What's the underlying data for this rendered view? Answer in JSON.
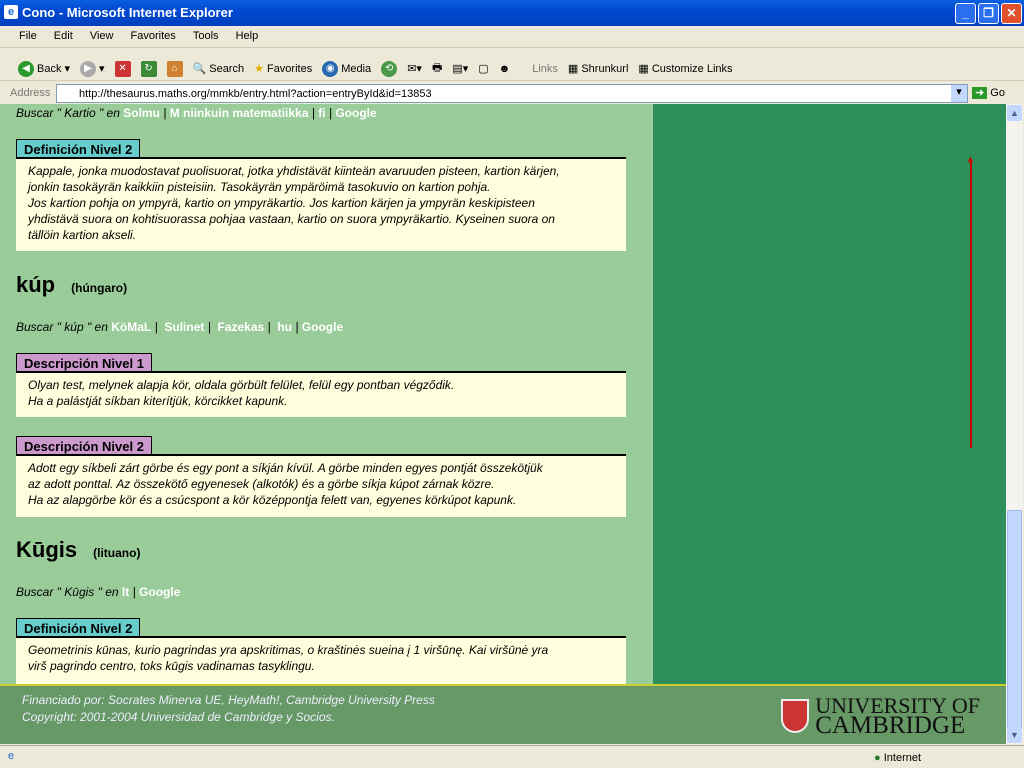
{
  "window": {
    "title": "Cono - Microsoft Internet Explorer"
  },
  "menu": [
    "File",
    "Edit",
    "View",
    "Favorites",
    "Tools",
    "Help"
  ],
  "toolbar": {
    "back": "Back",
    "search": "Search",
    "favorites": "Favorites",
    "media": "Media",
    "links": "Links",
    "shrunkurl": "Shrunkurl",
    "customize": "Customize Links"
  },
  "address": {
    "label": "Address",
    "url": "http://thesaurus.maths.org/mmkb/entry.html?action=entryById&id=13853",
    "go": "Go"
  },
  "entries": [
    {
      "search_prefix": "Buscar \" Kartio \" en ",
      "links": [
        "Solmu",
        "M niinkuin matematiikka",
        "fi",
        "Google"
      ],
      "blocks": [
        {
          "title": "Definición Nivel 2",
          "lines": [
            "Kappale, jonka muodostavat puolisuorat, jotka yhdistävät kiinteän avaruuden pisteen, kartion kärjen,",
            "jonkin tasokäyrän kaikkiin pisteisiin. Tasokäyrän ympäröimä tasokuvio on kartion pohja.",
            "Jos kartion pohja on ympyrä, kartio on ympyräkartio. Jos kartion kärjen ja ympyrän keskipisteen",
            "yhdistävä suora on kohtisuorassa pohjaa vastaan, kartio on suora ympyräkartio. Kyseinen suora on",
            "tällöin kartion akseli."
          ]
        }
      ]
    },
    {
      "term": "kúp",
      "language": "(húngaro)",
      "search_prefix": "Buscar \" kúp \" en ",
      "links": [
        "KöMaL",
        "Sulinet",
        "Fazekas",
        "hu",
        "Google"
      ],
      "blocks": [
        {
          "title": "Descripción Nivel 1",
          "lines": [
            "Olyan test, melynek alapja kör, oldala görbült felület, felül egy pontban végződik.",
            "Ha a palástját síkban kiterítjük, körcikket kapunk."
          ]
        },
        {
          "title": "Descripción Nivel 2",
          "lines": [
            "Adott egy síkbeli zárt görbe és egy pont a síkján kívül. A görbe minden egyes pontját összekötjük",
            "az adott ponttal. Az összekötő egyenesek (alkotók) és a görbe síkja kúpot zárnak közre.",
            "Ha az alapgörbe kör és a csúcspont a kör középpontja felett van, egyenes körkúpot kapunk."
          ]
        }
      ]
    },
    {
      "term": "Kūgis",
      "language": "(lituano)",
      "search_prefix": "Buscar \" Kūgis \" en ",
      "links": [
        "lt",
        "Google"
      ],
      "blocks": [
        {
          "title": "Definición Nivel 2",
          "lines": [
            "Geometrinis kūnas, kurio pagrindas yra apskritimas, o kraštinės sueina į 1 viršūnę. Kai viršūnė yra",
            "virš pagrindo centro, toks kūgis vadinamas tasyklingu."
          ]
        }
      ]
    }
  ],
  "footer": {
    "line1": "Financiado por: Socrates Minerva UE, HeyMath!, Cambridge University Press",
    "line2": "Copyright: 2001-2004 Universidad de Cambridge y Socios.",
    "logo_line1": "UNIVERSITY OF",
    "logo_line2": "CAMBRIDGE"
  },
  "status": {
    "zone": "Internet"
  },
  "colors": {
    "content_bg": "#99cc99",
    "right_bg": "#2f8f5a",
    "definition_tab": "#66cccc",
    "description_tab": "#cc99cc",
    "box_bg": "#ffffdd",
    "footer_bg": "#669966"
  }
}
